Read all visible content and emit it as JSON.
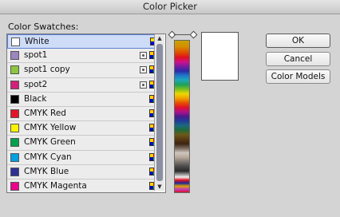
{
  "window": {
    "title": "Color Picker"
  },
  "swatches": {
    "label": "Color Swatches:",
    "items": [
      {
        "name": "White",
        "color": "#ffffff",
        "spot": false,
        "selected": true
      },
      {
        "name": "spot1",
        "color": "#9b86c0",
        "spot": true,
        "selected": false
      },
      {
        "name": "spot1 copy",
        "color": "#8cc63e",
        "spot": true,
        "selected": false
      },
      {
        "name": "spot2",
        "color": "#d4207c",
        "spot": true,
        "selected": false
      },
      {
        "name": "Black",
        "color": "#000000",
        "spot": false,
        "selected": false
      },
      {
        "name": "CMYK Red",
        "color": "#e3142a",
        "spot": false,
        "selected": false
      },
      {
        "name": "CMYK Yellow",
        "color": "#fff200",
        "spot": false,
        "selected": false
      },
      {
        "name": "CMYK Green",
        "color": "#00a14b",
        "spot": false,
        "selected": false
      },
      {
        "name": "CMYK Cyan",
        "color": "#00a0e3",
        "spot": false,
        "selected": false
      },
      {
        "name": "CMYK Blue",
        "color": "#2e3192",
        "spot": false,
        "selected": false
      },
      {
        "name": "CMYK Magenta",
        "color": "#ec008c",
        "spot": false,
        "selected": false
      }
    ]
  },
  "preview": {
    "color": "#ffffff"
  },
  "buttons": {
    "ok": "OK",
    "cancel": "Cancel",
    "color_models": "Color Models"
  },
  "icons": {
    "spot": "spot-color-icon",
    "mode": "process-color-mode-icon",
    "scroll_up": "▲",
    "scroll_down": "▼"
  }
}
